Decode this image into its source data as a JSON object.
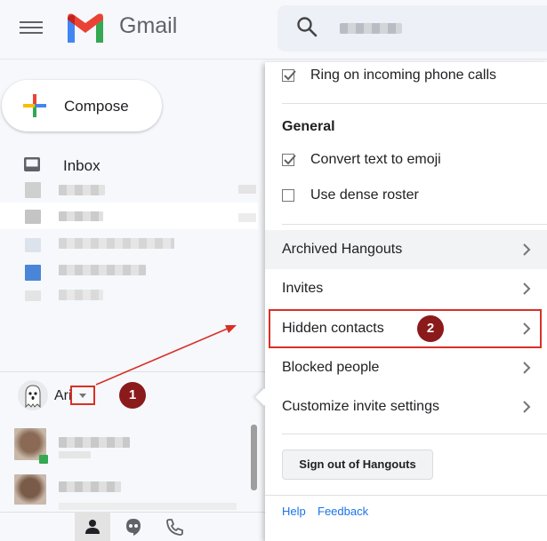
{
  "app": {
    "brand": "Gmail"
  },
  "search": {
    "placeholder": ""
  },
  "compose": {
    "label": "Compose"
  },
  "sidebar": {
    "inbox_label": "Inbox"
  },
  "hangouts": {
    "user_name": "Ari",
    "annotation_1": "1",
    "annotation_2": "2"
  },
  "settings": {
    "ring_label": "Ring on incoming phone calls",
    "ring_checked": true,
    "general_title": "General",
    "emoji_label": "Convert text to emoji",
    "emoji_checked": true,
    "dense_label": "Use dense roster",
    "dense_checked": false,
    "menu": [
      {
        "label": "Archived Hangouts"
      },
      {
        "label": "Invites"
      },
      {
        "label": "Hidden contacts"
      },
      {
        "label": "Blocked people"
      },
      {
        "label": "Customize invite settings"
      }
    ],
    "signout_label": "Sign out of Hangouts",
    "help_label": "Help",
    "feedback_label": "Feedback"
  },
  "icons": {
    "menu": "hamburger-menu-icon",
    "logo": "gmail-logo",
    "search": "search-icon",
    "compose": "plus-icon",
    "inbox": "inbox-icon",
    "avatar": "ghost-avatar",
    "dropdown": "caret-down-icon",
    "chevron": "chevron-right-icon",
    "people": "person-icon",
    "chat": "quote-bubble-icon",
    "phone": "phone-icon"
  },
  "colors": {
    "accent_red": "#d93025",
    "badge": "#8b1a1a",
    "link": "#1a73e8"
  }
}
